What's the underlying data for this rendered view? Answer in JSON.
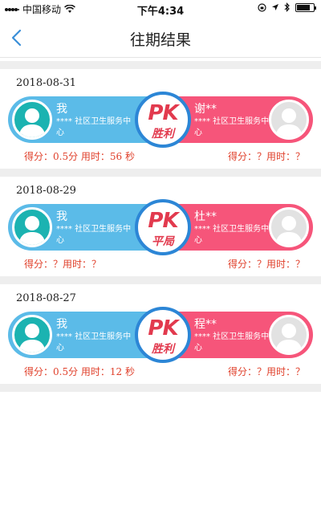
{
  "status_bar": {
    "carrier": "中国移动",
    "time": "下午4:34",
    "battery_level": 0.8
  },
  "nav": {
    "title": "往期结果"
  },
  "records": [
    {
      "date": "2018-08-31",
      "me": {
        "name": "我",
        "org": "**** 社区卫生服务中心"
      },
      "opponent": {
        "name": "谢**",
        "org": "**** 社区卫生服务中心"
      },
      "pk_label": "PK",
      "result": "胜利",
      "my_score": "得分：0.5分 用时：56 秒",
      "opponent_score": "得分：？用时：？"
    },
    {
      "date": "2018-08-29",
      "me": {
        "name": "我",
        "org": "**** 社区卫生服务中心"
      },
      "opponent": {
        "name": "杜**",
        "org": "**** 社区卫生服务中心"
      },
      "pk_label": "PK",
      "result": "平局",
      "my_score": "得分：？用时：？",
      "opponent_score": "得分：？用时：？"
    },
    {
      "date": "2018-08-27",
      "me": {
        "name": "我",
        "org": "**** 社区卫生服务中心"
      },
      "opponent": {
        "name": "程**",
        "org": "**** 社区卫生服务中心"
      },
      "pk_label": "PK",
      "result": "胜利",
      "my_score": "得分：0.5分 用时：12 秒",
      "opponent_score": "得分：？用时：？"
    }
  ],
  "colors": {
    "my_side": "#5bbbe8",
    "opponent_side": "#f6557a",
    "pk_text": "#e23a4e",
    "pk_ring": "#2c86d6",
    "score_text": "#e0402b",
    "back_arrow": "#3a8fd8"
  },
  "icons": {
    "back": "chevron-left-icon",
    "wifi": "wifi-icon",
    "avatar": "person-silhouette-icon",
    "status_right": [
      "screen-lock-icon",
      "location-icon",
      "bluetooth-icon",
      "battery-icon"
    ]
  }
}
